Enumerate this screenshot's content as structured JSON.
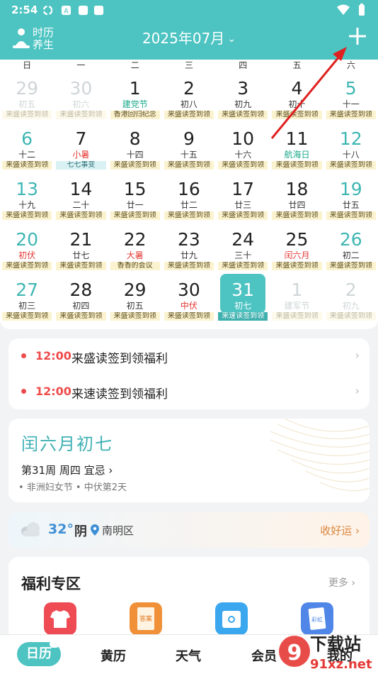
{
  "status": {
    "time": "2:54"
  },
  "header": {
    "logo_line1": "时历",
    "logo_line2": "养生",
    "month_title": "2025年07月",
    "month_chevron": "⌄"
  },
  "weekdays": [
    "日",
    "一",
    "二",
    "三",
    "四",
    "五",
    "六"
  ],
  "days": [
    {
      "d": "29",
      "l": "初五",
      "b": "来盛读签到领",
      "k": "other"
    },
    {
      "d": "30",
      "l": "初六",
      "b": "来盛读签到领",
      "k": "other"
    },
    {
      "d": "1",
      "l": "建党节",
      "b": "香港回归纪念",
      "lc": "green"
    },
    {
      "d": "2",
      "l": "初八",
      "b": "来盛读签到领"
    },
    {
      "d": "3",
      "l": "初九",
      "b": "来盛读签到领"
    },
    {
      "d": "4",
      "l": "初十",
      "b": "来盛读签到领"
    },
    {
      "d": "5",
      "l": "十一",
      "b": "来盛读签到领",
      "k": "weekend"
    },
    {
      "d": "6",
      "l": "十二",
      "b": "来盛读签到领",
      "k": "weekend"
    },
    {
      "d": "7",
      "l": "小暑",
      "b": "七七事变",
      "lc": "red",
      "bc": "blue"
    },
    {
      "d": "8",
      "l": "十四",
      "b": "来盛读签到领"
    },
    {
      "d": "9",
      "l": "十五",
      "b": "来盛读签到领"
    },
    {
      "d": "10",
      "l": "十六",
      "b": "来盛读签到领"
    },
    {
      "d": "11",
      "l": "航海日",
      "b": "来盛读签到领",
      "lc": "green"
    },
    {
      "d": "12",
      "l": "十八",
      "b": "来盛读签到领",
      "k": "weekend"
    },
    {
      "d": "13",
      "l": "十九",
      "b": "来盛读签到领",
      "k": "weekend"
    },
    {
      "d": "14",
      "l": "二十",
      "b": "来盛读签到领"
    },
    {
      "d": "15",
      "l": "廿一",
      "b": "来盛读签到领"
    },
    {
      "d": "16",
      "l": "廿二",
      "b": "来盛读签到领"
    },
    {
      "d": "17",
      "l": "廿三",
      "b": "来盛读签到领"
    },
    {
      "d": "18",
      "l": "廿四",
      "b": "来盛读签到领"
    },
    {
      "d": "19",
      "l": "廿五",
      "b": "来盛读签到领",
      "k": "weekend"
    },
    {
      "d": "20",
      "l": "初伏",
      "b": "来盛读签到领",
      "k": "weekend",
      "lc": "red"
    },
    {
      "d": "21",
      "l": "廿七",
      "b": "来盛读签到领"
    },
    {
      "d": "22",
      "l": "大暑",
      "b": "香香的会议",
      "lc": "red"
    },
    {
      "d": "23",
      "l": "廿九",
      "b": "来盛读签到领"
    },
    {
      "d": "24",
      "l": "三十",
      "b": "来盛读签到领"
    },
    {
      "d": "25",
      "l": "闰六月",
      "b": "来盛读签到领",
      "lc": "red"
    },
    {
      "d": "26",
      "l": "初二",
      "b": "来盛读签到领",
      "k": "weekend"
    },
    {
      "d": "27",
      "l": "初三",
      "b": "来盛读签到领",
      "k": "weekend"
    },
    {
      "d": "28",
      "l": "初四",
      "b": "来盛读签到领"
    },
    {
      "d": "29",
      "l": "初五",
      "b": "来盛读签到领"
    },
    {
      "d": "30",
      "l": "中伏",
      "b": "来盛读签到领",
      "lc": "red"
    },
    {
      "d": "31",
      "l": "初七",
      "b": "来速读签到领",
      "k": "today"
    },
    {
      "d": "1",
      "l": "建军节",
      "b": "来盛读签到领",
      "k": "other"
    },
    {
      "d": "2",
      "l": "初九",
      "b": "来盛读签到领",
      "k": "other"
    }
  ],
  "reminders": [
    {
      "time": "12:00",
      "text": "来盛读签到领福利",
      "arrow": "›"
    },
    {
      "time": "12:00",
      "text": "来速读签到领福利",
      "arrow": "›"
    }
  ],
  "almanac": {
    "title": "闰六月初七",
    "info": "第31周 周四 宜忌",
    "info_arrow": "›",
    "festivals": "• 非洲妇女节  • 中伏第2天"
  },
  "weather": {
    "temp": "32°",
    "condition": "阴",
    "location": "南明区",
    "fortune": "收好运 ›"
  },
  "welfare": {
    "title": "福利专区",
    "more": "更多 ›",
    "icons": [
      {
        "name": "shirt-gift",
        "color": "#ee4b55"
      },
      {
        "name": "answer-book",
        "color": "#f0913a",
        "label": "答案"
      },
      {
        "name": "card-box",
        "color": "#3aa7ef"
      },
      {
        "name": "rainbow-card",
        "color": "#4f86e8",
        "label": "彩虹"
      }
    ]
  },
  "tabs": [
    "日历",
    "黄历",
    "天气",
    "会员",
    "我的"
  ],
  "watermark": {
    "text1": "下载站",
    "text2": "91xz.net",
    "num": "9"
  },
  "colors": {
    "teal": "#4dc4c2",
    "red": "#ef4b4b",
    "orange": "#d9843a"
  }
}
